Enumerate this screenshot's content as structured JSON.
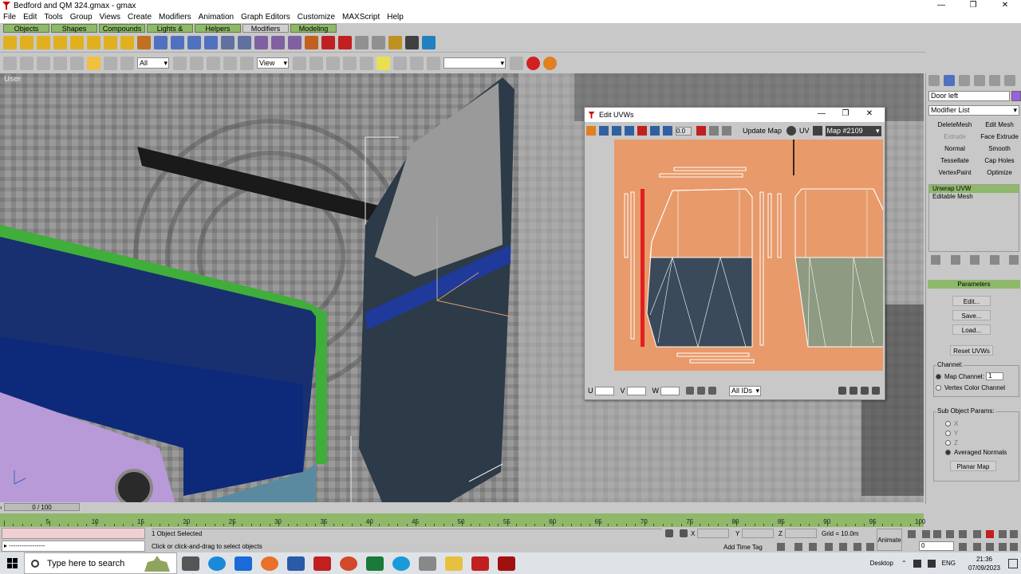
{
  "window": {
    "title": "Bedford and QM 324.gmax - gmax",
    "minimize": "—",
    "maximize": "❐",
    "close": "✕"
  },
  "menu": [
    "File",
    "Edit",
    "Tools",
    "Group",
    "Views",
    "Create",
    "Modifiers",
    "Animation",
    "Graph Editors",
    "Customize",
    "MAXScript",
    "Help"
  ],
  "tabs": [
    {
      "label": "Objects",
      "w": 58
    },
    {
      "label": "Shapes",
      "w": 58
    },
    {
      "label": "Compounds",
      "w": 58
    },
    {
      "label": "Lights & Cameras",
      "w": 58
    },
    {
      "label": "Helpers",
      "w": 58
    },
    {
      "label": "Modifiers",
      "w": 58,
      "active": true
    },
    {
      "label": "Modeling",
      "w": 58
    }
  ],
  "toolbar2": {
    "selection_filter": "All",
    "ref_coord": "View",
    "named_sel": ""
  },
  "viewport": {
    "label": "User"
  },
  "uvw": {
    "title": "Edit UVWs",
    "spinner_value": "0.0",
    "update_map": "Update Map",
    "uv_toggle": "UV",
    "map_select": "Map #2109",
    "u_label": "U",
    "v_label": "V",
    "w_label": "W",
    "ids_select": "All IDs"
  },
  "cmdpanel": {
    "object_name": "Door left",
    "modifier_list": "Modifier List",
    "modifiers": [
      {
        "label": "DeleteMesh",
        "disabled": false
      },
      {
        "label": "Edit Mesh",
        "disabled": false
      },
      {
        "label": "Extrude",
        "disabled": true
      },
      {
        "label": "Face Extrude",
        "disabled": false
      },
      {
        "label": "Normal",
        "disabled": false
      },
      {
        "label": "Smooth",
        "disabled": false
      },
      {
        "label": "Tessellate",
        "disabled": false
      },
      {
        "label": "Cap Holes",
        "disabled": false
      },
      {
        "label": "VertexPaint",
        "disabled": false
      },
      {
        "label": "Optimize",
        "disabled": false
      }
    ],
    "stack": [
      "Unwrap UVW",
      "Editable Mesh"
    ],
    "params_title": "Parameters",
    "edit_btn": "Edit...",
    "save_btn": "Save...",
    "load_btn": "Load...",
    "reset_btn": "Reset UVWs",
    "channel_label": "Channel:",
    "map_channel": "Map Channel:",
    "map_channel_value": "1",
    "vertex_color": "Vertex Color Channel",
    "subobj_label": "Sub Object Params:",
    "x": "X",
    "y": "Y",
    "z": "Z",
    "averaged": "Averaged Normals",
    "planar_btn": "Planar Map"
  },
  "timeline": {
    "slider": "0 / 100",
    "ticks": [
      "5",
      "10",
      "15",
      "20",
      "25",
      "30",
      "35",
      "40",
      "45",
      "50",
      "55",
      "60",
      "65",
      "70",
      "75",
      "80",
      "85",
      "90",
      "95",
      "100"
    ]
  },
  "status": {
    "maxscript_line": "▸ -----------------",
    "selected": "1 Object Selected",
    "prompt": "Click or click-and-drag to select objects",
    "x_label": "X",
    "y_label": "Y",
    "z_label": "Z",
    "grid": "Grid = 10.0m",
    "add_time_tag": "Add Time Tag",
    "animate": "Animate",
    "frame": "0"
  },
  "taskbar": {
    "search_placeholder": "Type here to search",
    "desktop": "Desktop",
    "lang": "ENG",
    "time": "21:36",
    "date": "07/09/2023"
  },
  "colors": {
    "uv_background": "#e89a6a",
    "trackbar": "#8fb86a",
    "door": "#2d3a48",
    "seat_blue": "#0d2a7a",
    "seat_green": "#3fae3a",
    "seat_purple": "#b89ad8"
  }
}
